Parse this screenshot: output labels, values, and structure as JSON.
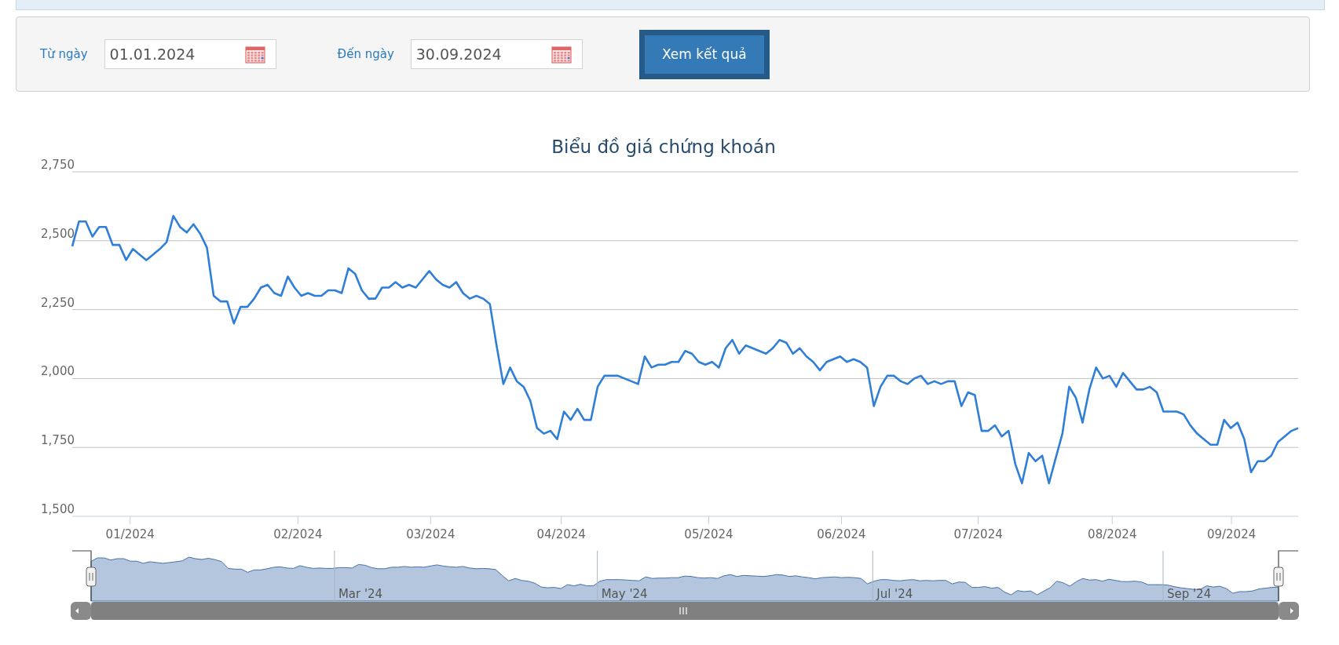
{
  "filter": {
    "from": {
      "label": "Từ ngày",
      "value": "01.01.2024"
    },
    "to": {
      "label": "Đến ngày",
      "value": "30.09.2024"
    },
    "submit": "Xem kết quả"
  },
  "chart": {
    "chart_data": {
      "type": "line",
      "title": "Biểu đồ giá chứng khoán",
      "grid": true,
      "ylim": [
        1500,
        2750
      ],
      "yticks": [
        {
          "value": 1500,
          "label": "1,500"
        },
        {
          "value": 1750,
          "label": "1,750"
        },
        {
          "value": 2000,
          "label": "2,000"
        },
        {
          "value": 2250,
          "label": "2,250"
        },
        {
          "value": 2500,
          "label": "2,500"
        },
        {
          "value": 2750,
          "label": "2,750"
        }
      ],
      "series": [
        {
          "color": "#2f7ed8",
          "values": [
            2480,
            2570,
            2570,
            2515,
            2550,
            2550,
            2485,
            2485,
            2430,
            2470,
            2450,
            2430,
            2450,
            2470,
            2495,
            2590,
            2550,
            2530,
            2560,
            2525,
            2475,
            2300,
            2280,
            2280,
            2200,
            2260,
            2260,
            2290,
            2330,
            2340,
            2310,
            2300,
            2370,
            2330,
            2300,
            2310,
            2300,
            2300,
            2320,
            2320,
            2310,
            2400,
            2380,
            2320,
            2290,
            2290,
            2330,
            2330,
            2350,
            2330,
            2340,
            2330,
            2360,
            2390,
            2360,
            2340,
            2330,
            2350,
            2310,
            2290,
            2300,
            2290,
            2270,
            2120,
            1980,
            2040,
            1990,
            1970,
            1920,
            1820,
            1800,
            1810,
            1780,
            1880,
            1850,
            1890,
            1850,
            1850,
            1970,
            2010,
            2010,
            2010,
            2000,
            1990,
            1980,
            2080,
            2040,
            2050,
            2050,
            2060,
            2060,
            2100,
            2090,
            2060,
            2050,
            2060,
            2040,
            2110,
            2140,
            2090,
            2120,
            2110,
            2100,
            2090,
            2110,
            2140,
            2130,
            2090,
            2110,
            2080,
            2060,
            2030,
            2060,
            2070,
            2080,
            2060,
            2070,
            2060,
            2040,
            1900,
            1970,
            2010,
            2010,
            1990,
            1980,
            2000,
            2010,
            1980,
            1990,
            1980,
            1990,
            1990,
            1900,
            1950,
            1940,
            1810,
            1810,
            1830,
            1790,
            1810,
            1690,
            1620,
            1730,
            1700,
            1720,
            1620,
            1710,
            1800,
            1970,
            1930,
            1840,
            1960,
            2040,
            2000,
            2010,
            1970,
            2020,
            1990,
            1960,
            1960,
            1970,
            1950,
            1880,
            1880,
            1880,
            1870,
            1830,
            1800,
            1780,
            1760,
            1760,
            1850,
            1820,
            1840,
            1780,
            1660,
            1700,
            1700,
            1720,
            1770,
            1790,
            1810,
            1820
          ]
        }
      ]
    },
    "x_labels": [
      "01/2024",
      "02/2024",
      "03/2024",
      "04/2024",
      "05/2024",
      "06/2024",
      "07/2024",
      "08/2024",
      "09/2024"
    ]
  },
  "navigator": {
    "labels": [
      "Mar '24",
      "May '24",
      "Jul '24",
      "Sep '24"
    ]
  }
}
